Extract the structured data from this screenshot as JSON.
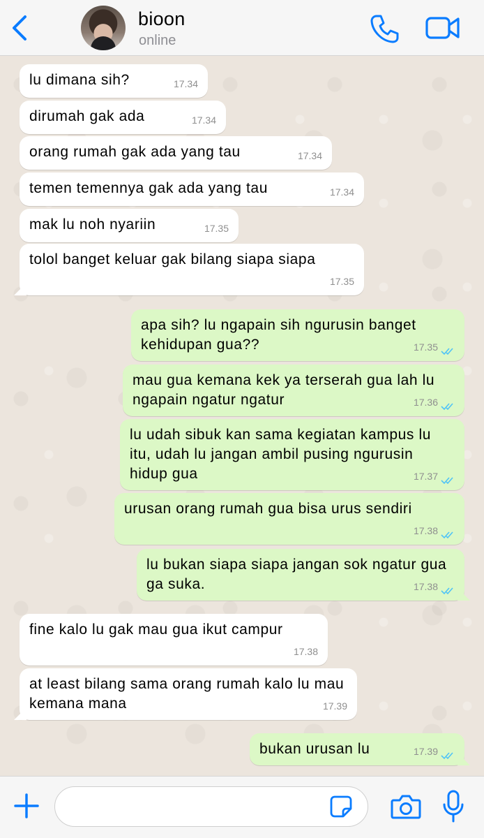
{
  "header": {
    "contact_name": "bioon",
    "status": "online",
    "icons": {
      "back": "chevron-left-icon",
      "call": "phone-icon",
      "video": "video-camera-icon"
    }
  },
  "colors": {
    "accent": "#0a7cff",
    "incoming_bubble": "#ffffff",
    "outgoing_bubble": "#dcf8c6",
    "read_ticks": "#4fc3f7",
    "chat_background": "#ece5dd"
  },
  "messages": [
    {
      "direction": "in",
      "text": "lu dimana sih?",
      "time": "17.34"
    },
    {
      "direction": "in",
      "text": "dirumah gak ada",
      "time": "17.34"
    },
    {
      "direction": "in",
      "text": "orang rumah gak ada yang tau",
      "time": "17.34"
    },
    {
      "direction": "in",
      "text": "temen temennya gak ada yang tau",
      "time": "17.34"
    },
    {
      "direction": "in",
      "text": "mak lu noh nyariin",
      "time": "17.35"
    },
    {
      "direction": "in",
      "text": "tolol banget keluar gak bilang siapa siapa",
      "time": "17.35"
    },
    {
      "direction": "out",
      "text": "apa sih? lu ngapain sih ngurusin banget kehidupan gua??",
      "time": "17.35",
      "status": "read"
    },
    {
      "direction": "out",
      "text": "mau gua kemana kek ya terserah gua lah lu ngapain ngatur ngatur",
      "time": "17.36",
      "status": "read"
    },
    {
      "direction": "out",
      "text": "lu udah sibuk kan sama kegiatan kampus lu itu, udah lu jangan ambil pusing ngurusin hidup gua",
      "time": "17.37",
      "status": "read"
    },
    {
      "direction": "out",
      "text": "urusan orang rumah gua bisa urus sendiri",
      "time": "17.38",
      "status": "read"
    },
    {
      "direction": "out",
      "text": "lu bukan siapa siapa jangan sok ngatur gua ga suka.",
      "time": "17.38",
      "status": "read"
    },
    {
      "direction": "in",
      "text": "fine kalo lu gak mau gua ikut campur",
      "time": "17.38"
    },
    {
      "direction": "in",
      "text": "at least bilang sama orang rumah kalo lu mau kemana mana",
      "time": "17.39"
    },
    {
      "direction": "out",
      "text": "bukan urusan lu",
      "time": "17.39",
      "status": "read"
    }
  ],
  "input_bar": {
    "message_value": "",
    "icons": {
      "add": "plus-icon",
      "sticker": "sticker-icon",
      "camera": "camera-icon",
      "mic": "microphone-icon"
    }
  }
}
